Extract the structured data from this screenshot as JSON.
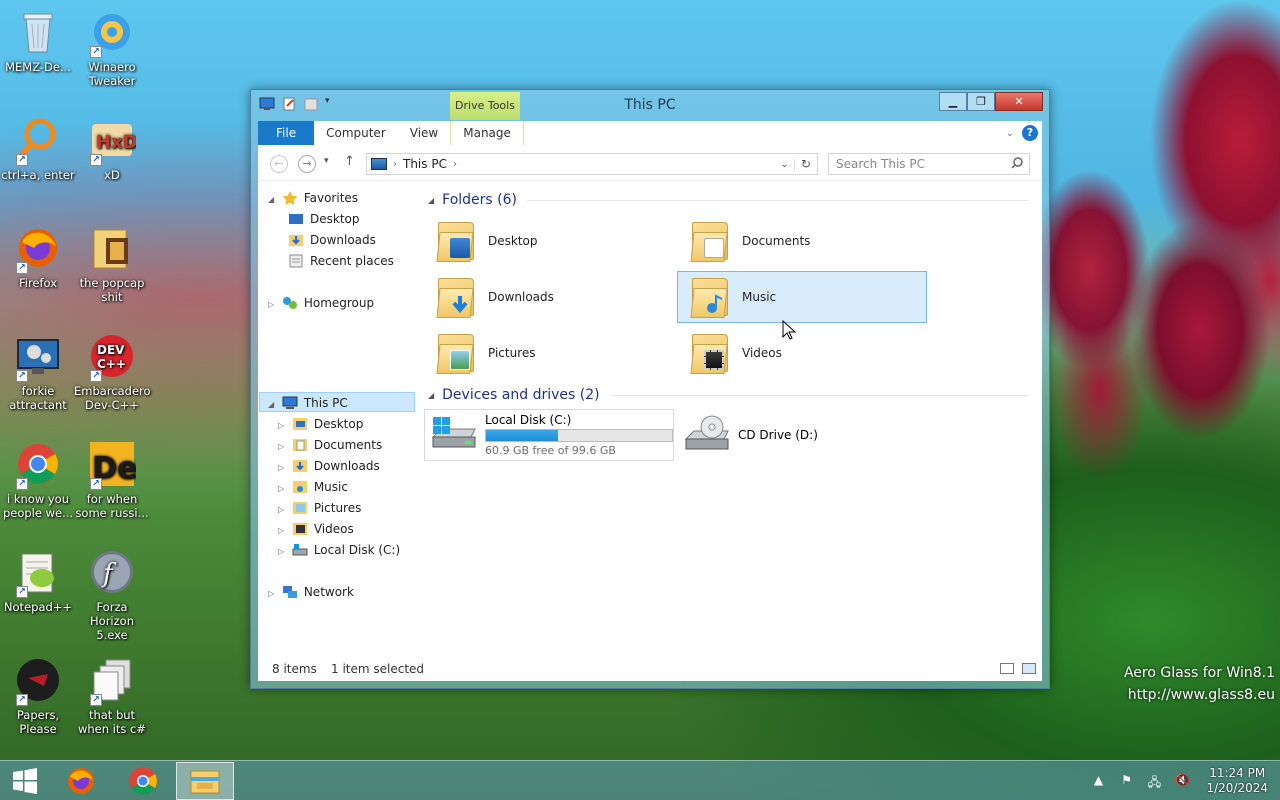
{
  "desktop": {
    "icons": [
      {
        "label": "MEMZ-De...",
        "icon": "recycle-bin-icon"
      },
      {
        "label": "Winaero Tweaker",
        "icon": "winaero-icon"
      },
      {
        "label": "ctrl+a, enter",
        "icon": "magnifier-icon"
      },
      {
        "label": "xD",
        "icon": "hxd-icon"
      },
      {
        "label": "Firefox",
        "icon": "firefox-icon"
      },
      {
        "label": "the popcap shit",
        "icon": "folder-icon"
      },
      {
        "label": "forkie attractant",
        "icon": "monitor-gear-icon"
      },
      {
        "label": "Embarcadero Dev-C++",
        "icon": "devcpp-icon"
      },
      {
        "label": "i know you people we...",
        "icon": "chrome-icon"
      },
      {
        "label": "for when some russi...",
        "icon": "de-icon"
      },
      {
        "label": "Notepad++",
        "icon": "notepadpp-icon"
      },
      {
        "label": "Forza Horizon 5.exe",
        "icon": "flash-icon"
      },
      {
        "label": "Papers, Please",
        "icon": "papers-please-icon"
      },
      {
        "label": "that but when its c#",
        "icon": "copies-icon"
      }
    ]
  },
  "window": {
    "title": "This PC",
    "contextual_tab": "Drive Tools",
    "tabs": [
      "File",
      "Computer",
      "View",
      "Manage"
    ],
    "address_path": "This PC",
    "search_placeholder": "Search This PC",
    "nav": {
      "favorites": "Favorites",
      "fav_items": [
        "Desktop",
        "Downloads",
        "Recent places"
      ],
      "homegroup": "Homegroup",
      "this_pc": "This PC",
      "pc_items": [
        "Desktop",
        "Documents",
        "Downloads",
        "Music",
        "Pictures",
        "Videos",
        "Local Disk (C:)"
      ],
      "network": "Network"
    },
    "folders_header": "Folders (6)",
    "folders": [
      "Desktop",
      "Documents",
      "Downloads",
      "Music",
      "Pictures",
      "Videos"
    ],
    "devices_header": "Devices and drives (2)",
    "drives": [
      {
        "name": "Local Disk (C:)",
        "free": "60.9 GB free of 99.6 GB",
        "used_fraction": 0.389
      },
      {
        "name": "CD Drive (D:)"
      }
    ],
    "status_items": "8 items",
    "status_selected": "1 item selected"
  },
  "watermark": {
    "line1": "Aero Glass for Win8.1",
    "line2": "http://www.glass8.eu"
  },
  "taskbar": {
    "time": "11:24 PM",
    "date": "1/20/2024"
  },
  "colors": {
    "accent": "#1979ca",
    "selection": "#cce8ff",
    "drive_fill": "#26a0da"
  }
}
